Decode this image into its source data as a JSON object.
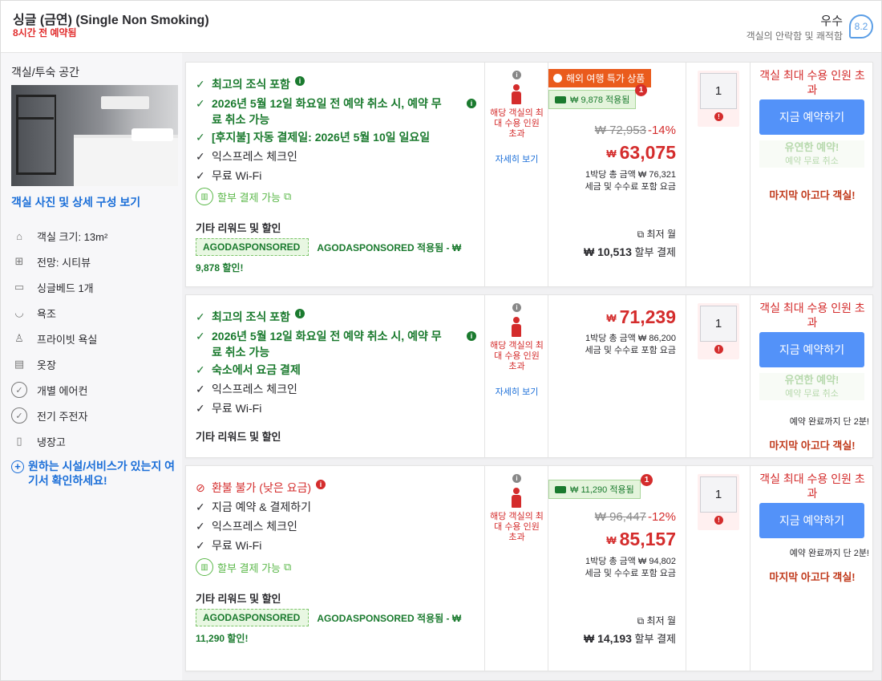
{
  "header": {
    "room_title": "싱글 (금연) (Single Non Smoking)",
    "booked_recent": "8시간 전 예약됨",
    "score_label": "우수",
    "score_sub": "객실의 안락함 및 쾌적함",
    "score": "8.2"
  },
  "sidebar": {
    "title": "객실/투숙 공간",
    "photo_link": "객실 사진 및 상세 구성 보기",
    "amenities": [
      {
        "label": "객실 크기: 13m²",
        "icon": "house-icon"
      },
      {
        "label": "전망: 시티뷰",
        "icon": "window-icon"
      },
      {
        "label": "싱글베드 1개",
        "icon": "bed-icon"
      },
      {
        "label": "욕조",
        "icon": "bathtub-icon"
      },
      {
        "label": "프라이빗 욕실",
        "icon": "toilet-icon"
      },
      {
        "label": "옷장",
        "icon": "wardrobe-icon"
      },
      {
        "label": "개별 에어컨",
        "icon": "check-circle-icon"
      },
      {
        "label": "전기 주전자",
        "icon": "check-circle-icon"
      },
      {
        "label": "냉장고",
        "icon": "fridge-icon"
      }
    ],
    "facility_link": "원하는 시설/서비스가 있는지 여기서 확인하세요!"
  },
  "offers": [
    {
      "features": [
        {
          "text": "최고의 조식 포함",
          "style": "green",
          "info": true
        },
        {
          "text": "2026년 5월 12일 화요일 전 예약 취소 시, 예약 무료 취소 가능",
          "line1": "2026년 5월 12일 화요일 전 예약 취소 시, 예약 무",
          "line2": "료 취소 가능",
          "style": "green",
          "info": true
        },
        {
          "text": "[후지불] 자동 결제일: 2026년 5월 10일 일요일",
          "style": "green",
          "info": false
        },
        {
          "text": "익스프레스 체크인",
          "style": "black"
        },
        {
          "text": "무료 Wi-Fi",
          "style": "black"
        }
      ],
      "installment": "할부 결제 가능",
      "other_rewards": "기타 리워드 및 할인",
      "promo_code": "AGODASPONSORED",
      "promo_applied": "AGODASPONSORED 적용됨 - ₩",
      "promo_cont": "9,878 할인!",
      "occupancy_text": "해당 객실의 최대 수용 인원 초과",
      "occupancy_link": "자세히 보기",
      "deal_badge": "해외 여행 특가 상품",
      "discount_badge": "₩ 9,878 적용됨",
      "badge_count": "1",
      "original_price": "₩ 72,953",
      "discount_pct": "-14%",
      "currency": "₩",
      "price": "63,075",
      "per_night": "1박당 총 금액 ₩ 76,321",
      "tax_note": "세금 및 수수료 포함 요금",
      "min_month": "최저 월",
      "installment_price": "₩ 10,513",
      "installment_suffix": "할부 결제",
      "quantity": "1",
      "capacity_warning": "객실 최대 수용 인원 초과",
      "book_label": "지금 예약하기",
      "flex_title": "유연한 예약!",
      "flex_sub": "예약 무료 취소",
      "last_room": "마지막 아고다 객실!"
    },
    {
      "features": [
        {
          "text": "최고의 조식 포함",
          "style": "green",
          "info": true
        },
        {
          "text": "2026년 5월 12일 화요일 전 예약 취소 시, 예약 무료 취소 가능",
          "line1": "2026년 5월 12일 화요일 전 예약 취소 시, 예약 무",
          "line2": "료 취소 가능",
          "style": "green",
          "info": true
        },
        {
          "text": "숙소에서 요금 결제",
          "style": "green",
          "info": false
        },
        {
          "text": "익스프레스 체크인",
          "style": "black"
        },
        {
          "text": "무료 Wi-Fi",
          "style": "black"
        }
      ],
      "other_rewards": "기타 리워드 및 할인",
      "occupancy_text": "해당 객실의 최대 수용 인원 초과",
      "occupancy_link": "자세히 보기",
      "currency": "₩",
      "price": "71,239",
      "per_night": "1박당 총 금액 ₩ 86,200",
      "tax_note": "세금 및 수수료 포함 요금",
      "quantity": "1",
      "capacity_warning": "객실 최대 수용 인원 초과",
      "book_label": "지금 예약하기",
      "flex_title": "유연한 예약!",
      "flex_sub": "예약 무료 취소",
      "until_done": "예약 완료까지 단 2분!",
      "last_room": "마지막 아고다 객실!"
    },
    {
      "features": [
        {
          "text": "환불 불가 (낮은 요금)",
          "style": "red",
          "info": true
        },
        {
          "text": "지금 예약 & 결제하기",
          "style": "black"
        },
        {
          "text": "익스프레스 체크인",
          "style": "black"
        },
        {
          "text": "무료 Wi-Fi",
          "style": "black"
        }
      ],
      "installment": "할부 결제 가능",
      "other_rewards": "기타 리워드 및 할인",
      "promo_code": "AGODASPONSORED",
      "promo_applied": "AGODASPONSORED 적용됨 - ₩",
      "promo_cont": "11,290 할인!",
      "occupancy_text": "해당 객실의 최대 수용 인원 초과",
      "discount_badge": "₩ 11,290 적용됨",
      "badge_count": "1",
      "original_price": "₩ 96,447",
      "discount_pct": "-12%",
      "currency": "₩",
      "price": "85,157",
      "per_night": "1박당 총 금액 ₩ 94,802",
      "tax_note": "세금 및 수수료 포함 요금",
      "min_month": "최저 월",
      "installment_price": "₩ 14,193",
      "installment_suffix": "할부 결제",
      "quantity": "1",
      "capacity_warning": "객실 최대 수용 인원 초과",
      "book_label": "지금 예약하기",
      "until_done": "예약 완료까지 단 2분!",
      "last_room": "마지막 아고다 객실!"
    }
  ],
  "colors": {
    "accent_blue": "#5392f9",
    "price_red": "#d42c2c",
    "green": "#1a7a2e",
    "orange_badge": "#ea5b1c"
  }
}
